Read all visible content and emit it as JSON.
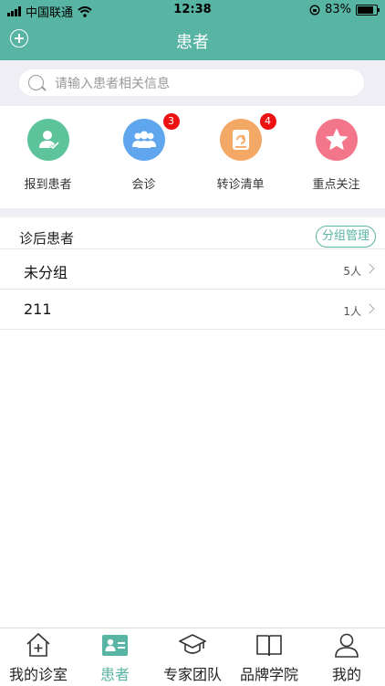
{
  "status": {
    "carrier": "中国联通",
    "time": "12:38",
    "battery": "83%",
    "battery_level": 0.83
  },
  "nav": {
    "title": "患者"
  },
  "search": {
    "placeholder": "请输入患者相关信息"
  },
  "quick_actions": [
    {
      "label": "报到患者",
      "icon": "person-check-icon",
      "color": "#5dc39b",
      "badge": ""
    },
    {
      "label": "会诊",
      "icon": "group-icon",
      "color": "#5fa6ee",
      "badge": "3"
    },
    {
      "label": "转诊清单",
      "icon": "referral-icon",
      "color": "#f4a865",
      "badge": "4"
    },
    {
      "label": "重点关注",
      "icon": "star-icon",
      "color": "#f2758a",
      "badge": ""
    }
  ],
  "section": {
    "title": "诊后患者",
    "manage_label": "分组管理",
    "groups": [
      {
        "name": "未分组",
        "count": "5人"
      },
      {
        "name": "211",
        "count": "1人"
      }
    ]
  },
  "tabs": [
    {
      "label": "我的诊室",
      "icon": "house-plus-icon",
      "active": false
    },
    {
      "label": "患者",
      "icon": "patient-card-icon",
      "active": true
    },
    {
      "label": "专家团队",
      "icon": "graduation-cap-icon",
      "active": false
    },
    {
      "label": "品牌学院",
      "icon": "book-icon",
      "active": false
    },
    {
      "label": "我的",
      "icon": "user-icon",
      "active": false
    }
  ],
  "colors": {
    "accent": "#59b5a3",
    "badge": "#ee1111"
  }
}
